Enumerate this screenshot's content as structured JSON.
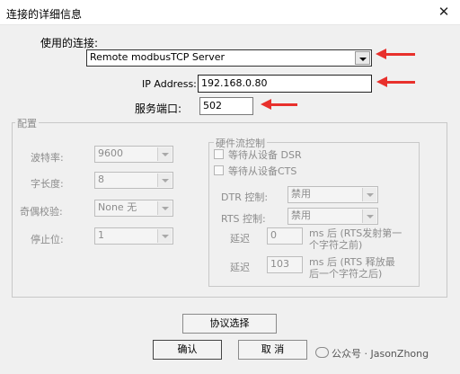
{
  "window": {
    "title": "连接的详细信息",
    "close_glyph": "✕"
  },
  "connection": {
    "label": "使用的连接:",
    "value": "Remote modbusTCP Server"
  },
  "ip": {
    "label": "IP Address:",
    "value": "192.168.0.80"
  },
  "port": {
    "label": "服务端口:",
    "value": "502"
  },
  "config": {
    "title": "配置",
    "baud": {
      "label": "波特率:",
      "value": "9600"
    },
    "length": {
      "label": "字长度:",
      "value": "8"
    },
    "parity": {
      "label": "奇偶校验:",
      "value": "None 无"
    },
    "stop": {
      "label": "停止位:",
      "value": "1"
    }
  },
  "flow": {
    "title": "硬件流控制",
    "wait_dsr": "等待从设备 DSR",
    "wait_cts": "等待从设备CTS",
    "dtr": {
      "label": "DTR 控制:",
      "value": "禁用"
    },
    "rts": {
      "label": "RTS 控制:",
      "value": "禁用"
    },
    "delay1": {
      "label": "延迟",
      "value": "0",
      "note_line1": "ms 后 (RTS发射第一",
      "note_line2": "个字符之前)"
    },
    "delay2": {
      "label": "延迟",
      "value": "103",
      "note_line1": "ms 后 (RTS 释放最",
      "note_line2": "后一个字符之后)"
    }
  },
  "buttons": {
    "protocol": "协议选择",
    "ok": "确认",
    "cancel": "取 消"
  },
  "watermark": {
    "text": "公众号 · JasonZhong"
  },
  "colors": {
    "annotation_arrow": "#e8302c"
  }
}
